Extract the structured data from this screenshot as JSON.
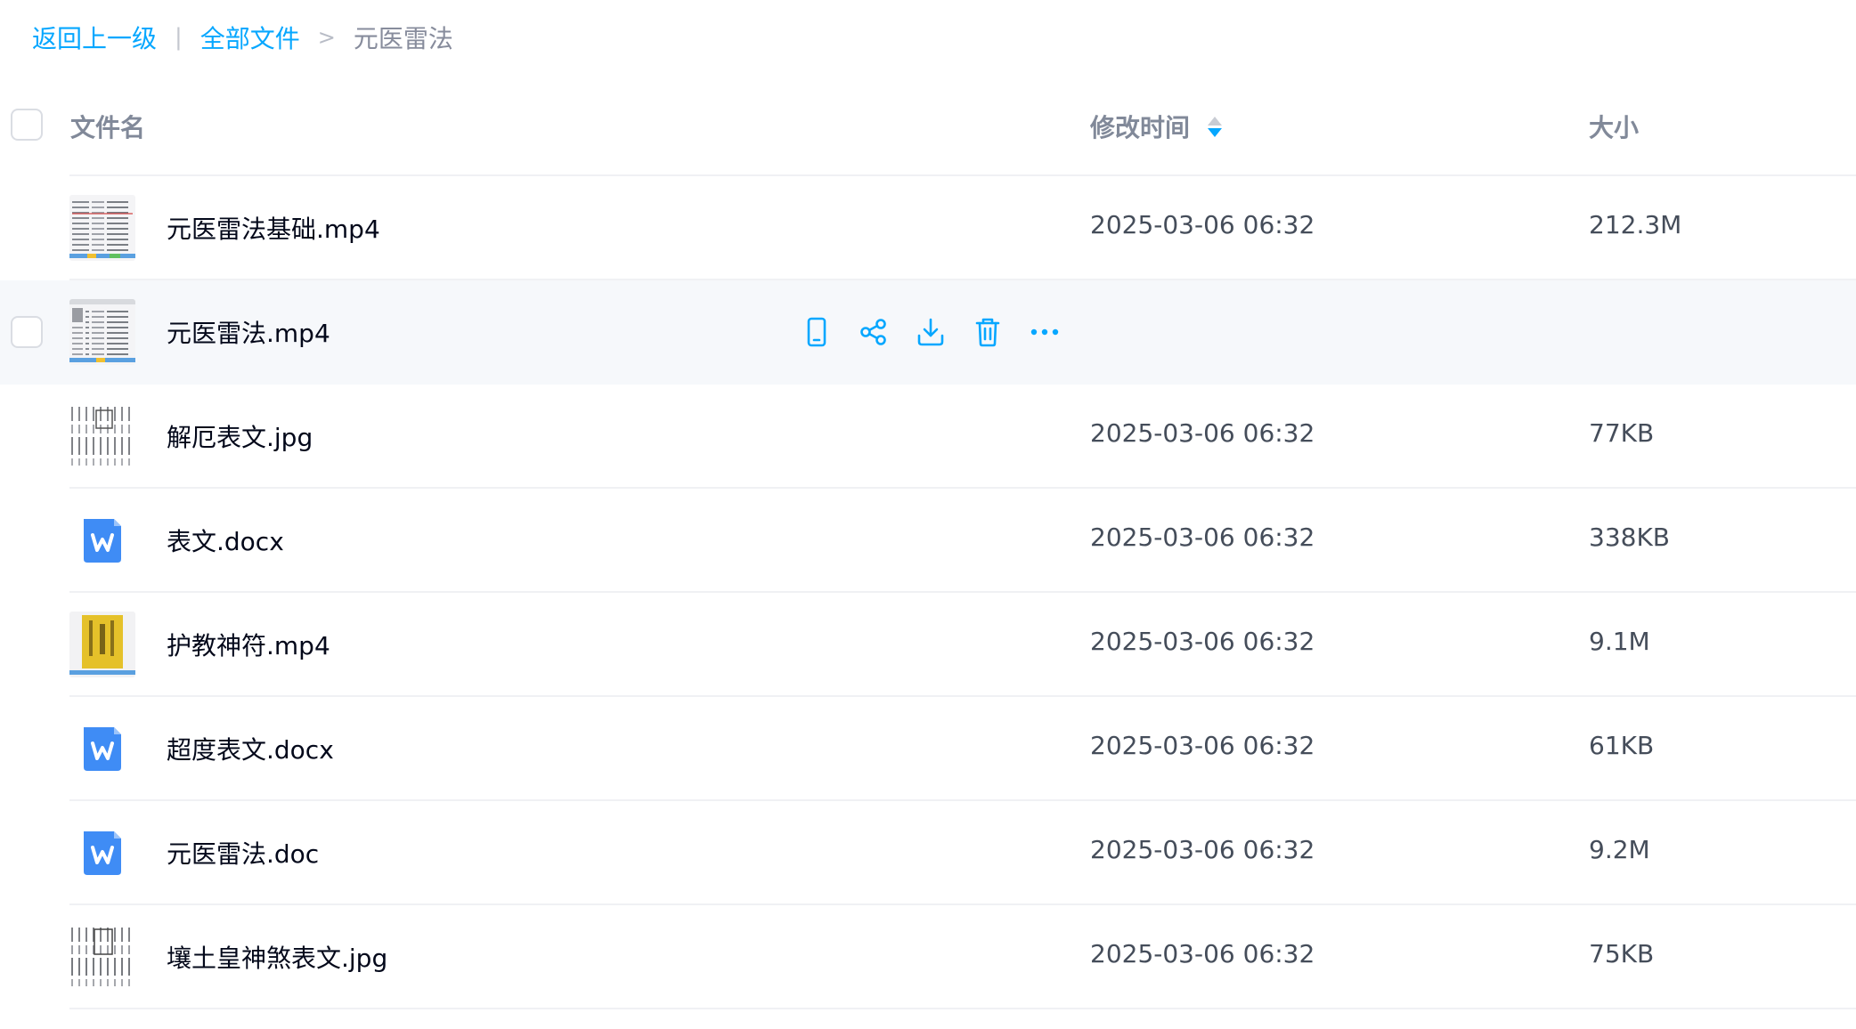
{
  "breadcrumb": {
    "back": "返回上一级",
    "separator": "|",
    "root": "全部文件",
    "arrow": ">",
    "current": "元医雷法"
  },
  "header": {
    "name": "文件名",
    "modified": "修改时间",
    "size": "大小"
  },
  "theme": {
    "accent": "#06a7ff",
    "word_icon": "#3f8cf5"
  },
  "files": [
    {
      "name": "元医雷法基础.mp4",
      "modified": "2025-03-06 06:32",
      "size": "212.3M",
      "icon": "video-thumbnail-icon"
    },
    {
      "name": "元医雷法.mp4",
      "modified": "",
      "size": "",
      "icon": "video-thumbnail-icon",
      "hovered": true
    },
    {
      "name": "解厄表文.jpg",
      "modified": "2025-03-06 06:32",
      "size": "77KB",
      "icon": "image-thumbnail-icon"
    },
    {
      "name": "表文.docx",
      "modified": "2025-03-06 06:32",
      "size": "338KB",
      "icon": "word-doc-icon"
    },
    {
      "name": "护教神符.mp4",
      "modified": "2025-03-06 06:32",
      "size": "9.1M",
      "icon": "video-thumbnail-icon"
    },
    {
      "name": "超度表文.docx",
      "modified": "2025-03-06 06:32",
      "size": "61KB",
      "icon": "word-doc-icon"
    },
    {
      "name": "元医雷法.doc",
      "modified": "2025-03-06 06:32",
      "size": "9.2M",
      "icon": "word-doc-icon"
    },
    {
      "name": "壤土皇神煞表文.jpg",
      "modified": "2025-03-06 06:32",
      "size": "75KB",
      "icon": "image-thumbnail-icon"
    }
  ],
  "row_actions": [
    "phone-icon",
    "share-icon",
    "download-icon",
    "delete-icon",
    "more-icon"
  ]
}
